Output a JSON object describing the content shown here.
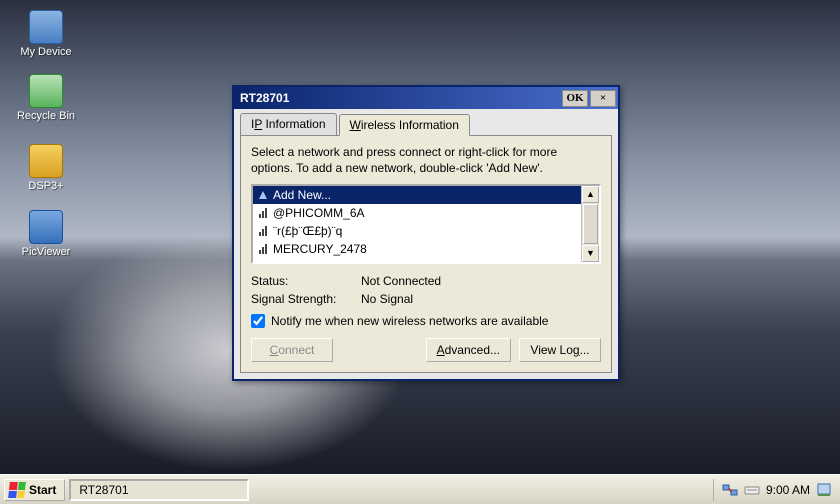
{
  "icons": {
    "my_device": "My Device",
    "recycle_bin": "Recycle Bin",
    "dsp3": "DSP3+",
    "picviewer": "PicViewer"
  },
  "window": {
    "title": "RT28701",
    "ok": "OK",
    "close": "×",
    "tabs": {
      "ip": "IP Information",
      "wireless": "Wireless Information"
    },
    "instruction": "Select a network and press connect or right-click for more options.  To add a new network, double-click 'Add New'.",
    "networks": [
      "Add New...",
      "@PHICOMM_6A",
      "¨r(£þ¨Œ£þ)¨q",
      "MERCURY_2478"
    ],
    "status": {
      "status_label": "Status:",
      "status_value": "Not Connected",
      "signal_label": "Signal Strength:",
      "signal_value": "No Signal"
    },
    "notify_label": "Notify me when new wireless networks are available",
    "buttons": {
      "connect": "Connect",
      "advanced": "Advanced...",
      "viewlog": "View Log..."
    }
  },
  "taskbar": {
    "start": "Start",
    "task1": "RT28701",
    "clock": "9:00 AM"
  }
}
